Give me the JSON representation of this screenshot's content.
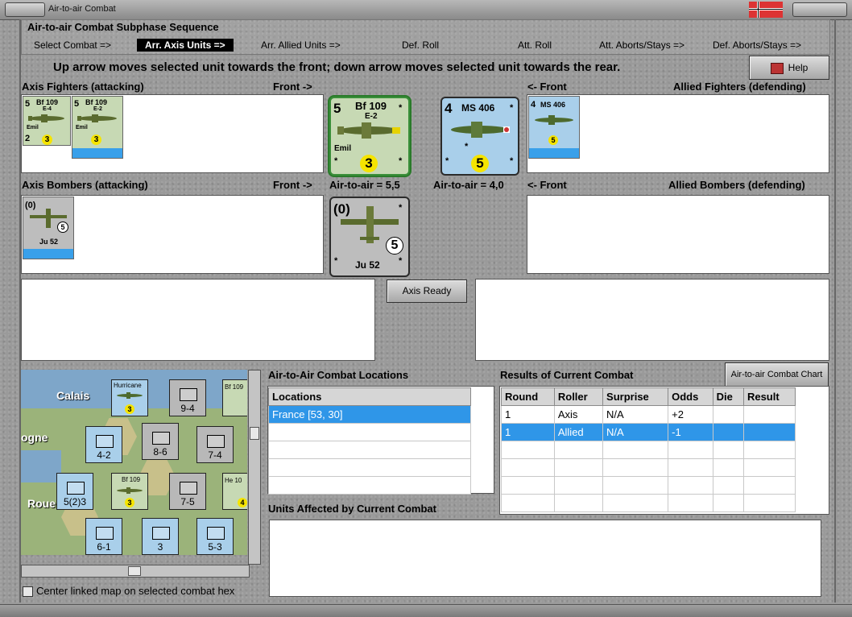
{
  "window": {
    "title": "Air-to-air Combat"
  },
  "sequence": {
    "title": "Air-to-air Combat Subphase Sequence",
    "steps": [
      {
        "label": "Select Combat =>"
      },
      {
        "label": "Arr. Axis Units =>"
      },
      {
        "label": "Arr. Allied Units =>"
      },
      {
        "label": "Def. Roll"
      },
      {
        "label": "Att. Roll"
      },
      {
        "label": "Att. Aborts/Stays =>"
      },
      {
        "label": "Def. Aborts/Stays =>"
      }
    ],
    "active_index": 1
  },
  "instruction": "Up arrow moves selected unit towards the front; down arrow moves selected unit towards the rear.",
  "help_label": "Help",
  "labels": {
    "axis_fighters": "Axis Fighters (attacking)",
    "front_right": "Front ->",
    "front_left": "<- Front",
    "allied_fighters": "Allied Fighters (defending)",
    "axis_bombers": "Axis Bombers (attacking)",
    "air_to_air_axis": "Air-to-air = 5,5",
    "air_to_air_allied": "Air-to-air = 4,0",
    "allied_bombers": "Allied Bombers (defending)",
    "axis_ready": "Axis Ready",
    "locations_title": "Air-to-Air Combat Locations",
    "results_title": "Results of Current Combat",
    "chart_button": "Air-to-air Combat Chart",
    "affected_title": "Units Affected by Current Combat",
    "center_map": "Center linked map on selected combat hex"
  },
  "axis_fighters": [
    {
      "name": "Bf 109",
      "model": "E-4",
      "nick": "Emil",
      "range": "5",
      "bottom": "2",
      "rating": "3"
    },
    {
      "name": "Bf 109",
      "model": "E-2",
      "nick": "Emil",
      "range": "5",
      "rating": "3"
    }
  ],
  "big_axis_fighter": {
    "range": "5",
    "name": "Bf 109",
    "model": "E-2",
    "nick": "Emil",
    "rating": "3"
  },
  "big_allied_fighter": {
    "range": "4",
    "name": "MS 406",
    "rating": "5"
  },
  "allied_fighters": [
    {
      "range": "4",
      "name": "MS 406",
      "rating": "5"
    }
  ],
  "axis_bombers": [
    {
      "range": "(0)",
      "name": "Ju 52",
      "rating": "5"
    }
  ],
  "big_axis_bomber": {
    "range": "(0)",
    "name": "Ju 52",
    "rating": "5"
  },
  "locations": {
    "header": "Locations",
    "rows": [
      "France [53, 30]",
      "",
      "",
      "",
      ""
    ]
  },
  "results": {
    "headers": [
      "Round",
      "Roller",
      "Surprise",
      "Odds",
      "Die",
      "Result"
    ],
    "rows": [
      [
        "1",
        "Axis",
        "N/A",
        "+2",
        "",
        ""
      ],
      [
        "1",
        "Allied",
        "N/A",
        "-1",
        "",
        ""
      ],
      [
        "",
        "",
        "",
        "",
        "",
        ""
      ],
      [
        "",
        "",
        "",
        "",
        "",
        ""
      ],
      [
        "",
        "",
        "",
        "",
        "",
        ""
      ],
      [
        "",
        "",
        "",
        "",
        "",
        ""
      ]
    ],
    "selected_row": 1
  },
  "map": {
    "places": [
      "Calais",
      "ogne",
      "Roue"
    ],
    "units": [
      {
        "val": "9-4"
      },
      {
        "val": "4-2"
      },
      {
        "val": "8-6"
      },
      {
        "val": "7-4"
      },
      {
        "val": "5(2)3"
      },
      {
        "val": "7-5"
      },
      {
        "val": "6-1"
      },
      {
        "val": "3"
      },
      {
        "val": "5-3"
      }
    ],
    "fighter_names": [
      "Hurricane",
      "Bf 109",
      "He 10"
    ],
    "fighter_ratings": [
      "3",
      "3",
      "4"
    ]
  },
  "colors": {
    "selection": "#2f96e8",
    "active_step": "#000000"
  }
}
